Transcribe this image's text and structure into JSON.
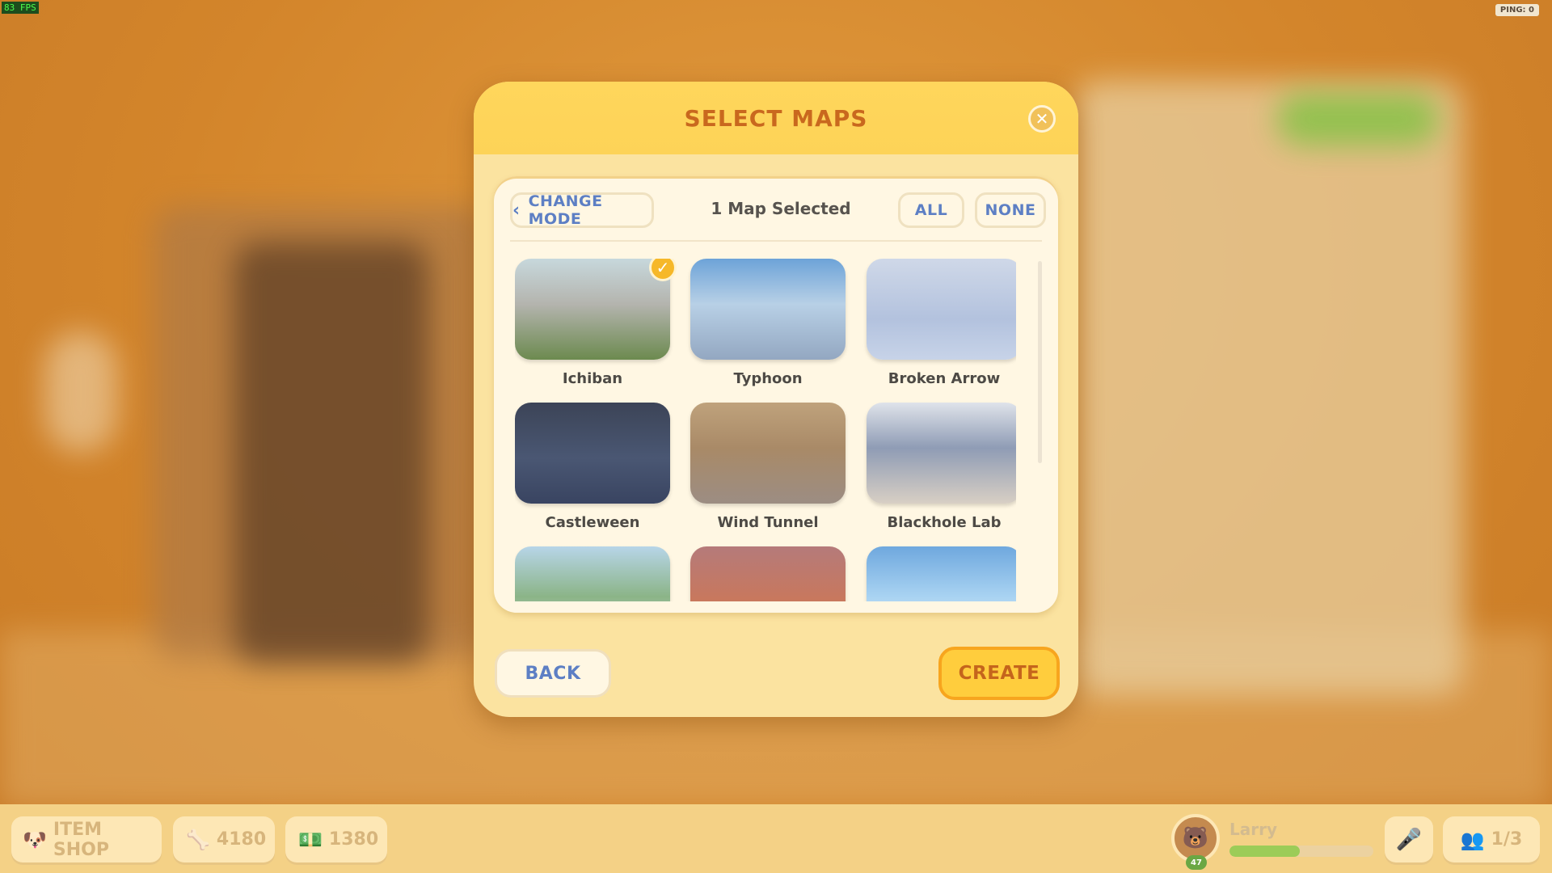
{
  "debug": {
    "fps": "83 FPS",
    "ping": "PING: 0"
  },
  "modal": {
    "title": "SELECT MAPS",
    "close_icon": "close-icon",
    "change_mode_label": "CHANGE MODE",
    "selected_text": "1 Map Selected",
    "all_label": "ALL",
    "none_label": "NONE",
    "maps": [
      {
        "name": "Ichiban",
        "selected": true
      },
      {
        "name": "Typhoon",
        "selected": false
      },
      {
        "name": "Broken Arrow",
        "selected": false
      },
      {
        "name": "Castleween",
        "selected": false
      },
      {
        "name": "Wind Tunnel",
        "selected": false
      },
      {
        "name": "Blackhole Lab",
        "selected": false
      },
      {
        "name": "",
        "selected": false
      },
      {
        "name": "",
        "selected": false
      },
      {
        "name": "",
        "selected": false
      }
    ],
    "back_label": "BACK",
    "create_label": "CREATE"
  },
  "hud": {
    "item_shop_label": "ITEM SHOP",
    "bones": "4180",
    "cash": "1380",
    "player_name": "Larry",
    "level": "47",
    "xp_fraction": 0.49,
    "party": "1/3"
  },
  "colors": {
    "accent_blue": "#5d7fc4",
    "title_orange": "#c9681e",
    "create_yellow": "#ffcd3d"
  }
}
